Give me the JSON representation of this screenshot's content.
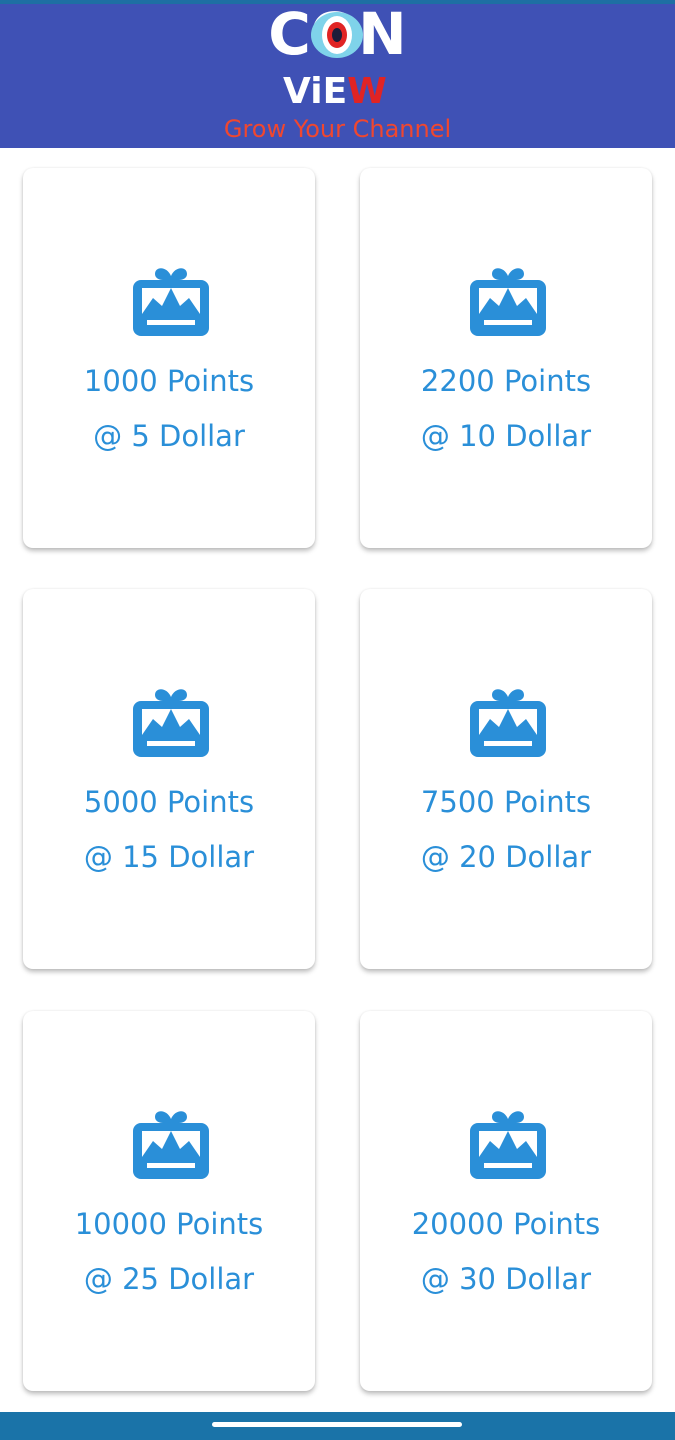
{
  "header": {
    "logo_top": "CON",
    "logo_bottom_prefix": "ViE",
    "logo_bottom_w": "W",
    "tagline": "Grow Your Channel"
  },
  "packages": [
    {
      "points": "1000 Points",
      "price": "@ 5 Dollar"
    },
    {
      "points": "2200 Points",
      "price": "@ 10 Dollar"
    },
    {
      "points": "5000 Points",
      "price": "@ 15 Dollar"
    },
    {
      "points": "7500 Points",
      "price": "@ 20 Dollar"
    },
    {
      "points": "10000 Points",
      "price": "@ 25 Dollar"
    },
    {
      "points": "20000 Points",
      "price": "@ 30 Dollar"
    }
  ],
  "icons": {
    "package": "gift-card-icon"
  },
  "colors": {
    "header_bg": "#3f51b5",
    "accent_blue": "#2a8fd8",
    "tagline_red": "#f0472f",
    "nav_bar": "#1a73a8"
  }
}
